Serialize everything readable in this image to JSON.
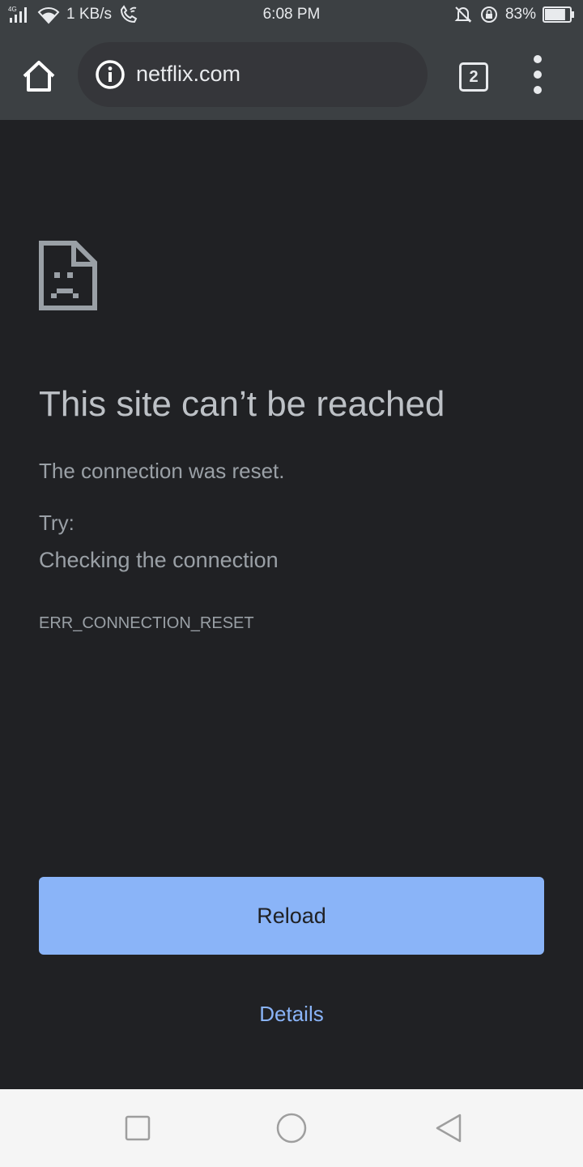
{
  "status_bar": {
    "network_type": "4G",
    "speed": "1 KB/s",
    "time": "6:08 PM",
    "battery_percent": "83%",
    "battery_level": 0.83
  },
  "toolbar": {
    "url": "netflix.com",
    "tab_count": "2"
  },
  "error": {
    "title": "This site can’t be reached",
    "description": "The connection was reset.",
    "try_label": "Try:",
    "suggestion": "Checking the connection",
    "code": "ERR_CONNECTION_RESET"
  },
  "actions": {
    "reload_label": "Reload",
    "details_label": "Details"
  },
  "colors": {
    "page_background": "#202124",
    "toolbar_background": "#3c4043",
    "omnibox_background": "#35363a",
    "accent": "#8ab4f8",
    "title_text": "#bdc1c6",
    "body_text": "#9aa0a6",
    "nav_bar_background": "#f5f5f5"
  },
  "icons": {
    "home": "home-icon",
    "site_info": "info-icon",
    "tab_switcher": "tab-switcher-icon",
    "overflow_menu": "more-vert-icon",
    "sad_page": "sad-page-icon",
    "nav_recents": "square-icon",
    "nav_home": "circle-icon",
    "nav_back": "triangle-back-icon"
  }
}
